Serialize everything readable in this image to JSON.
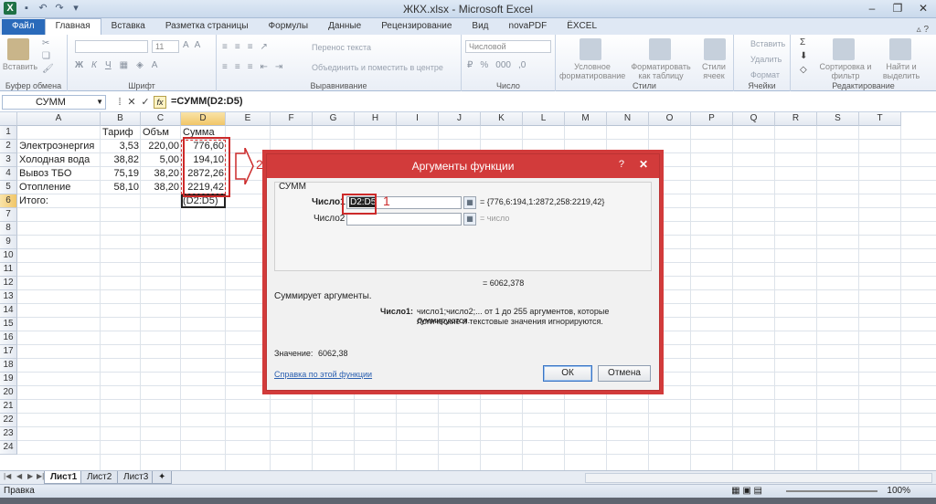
{
  "window": {
    "title": "ЖКХ.xlsx - Microsoft Excel"
  },
  "ribbon": {
    "tabs": [
      "Файл",
      "Главная",
      "Вставка",
      "Разметка страницы",
      "Формулы",
      "Данные",
      "Рецензирование",
      "Вид",
      "novaPDF",
      "ЁXCEL"
    ],
    "active_tab": "Главная",
    "groups": {
      "clipboard": {
        "label": "Буфер обмена",
        "paste": "Вставить"
      },
      "font": {
        "label": "Шрифт",
        "size": "11"
      },
      "alignment": {
        "label": "Выравнивание",
        "wrap": "Перенос текста",
        "merge": "Объединить и поместить в центре"
      },
      "number": {
        "label": "Число",
        "format": "Числовой"
      },
      "styles": {
        "label": "Стили",
        "cond": "Условное форматирование",
        "table": "Форматировать как таблицу",
        "cell": "Стили ячеек"
      },
      "cells": {
        "label": "Ячейки",
        "insert": "Вставить",
        "delete": "Удалить",
        "format": "Формат"
      },
      "editing": {
        "label": "Редактирование",
        "sort": "Сортировка и фильтр",
        "find": "Найти и выделить"
      }
    }
  },
  "formula_bar": {
    "name_box": "СУММ",
    "formula": "=СУММ(D2:D5)"
  },
  "grid": {
    "columns": [
      "A",
      "B",
      "C",
      "D",
      "E",
      "F",
      "G",
      "H",
      "I",
      "J",
      "K",
      "L",
      "M",
      "N",
      "O",
      "P",
      "Q",
      "R",
      "S",
      "T"
    ],
    "rows": [
      "1",
      "2",
      "3",
      "4",
      "5",
      "6",
      "7",
      "8",
      "9",
      "10",
      "11",
      "12",
      "13",
      "14",
      "15",
      "16",
      "17",
      "18",
      "19",
      "20",
      "21",
      "22",
      "23",
      "24"
    ],
    "cells": {
      "B1": "Тариф",
      "C1": "Объм",
      "D1": "Сумма",
      "A2": "Электроэнергия",
      "B2": "3,53",
      "C2": "220,00",
      "D2": "776,60",
      "A3": "Холодная вода",
      "B3": "38,82",
      "C3": "5,00",
      "D3": "194,10",
      "A4": "Вывоз ТБО",
      "B4": "75,19",
      "C4": "38,20",
      "D4": "2872,26",
      "A5": "Отопление",
      "B5": "58,10",
      "C5": "38,20",
      "D5": "2219,42",
      "A6": "Итого:",
      "D6": "(D2:D5)"
    }
  },
  "annotations": {
    "one": "1",
    "two": "2"
  },
  "dialog": {
    "title": "Аргументы функции",
    "help_glyph": "?",
    "close_glyph": "✕",
    "function_name": "СУММ",
    "arg1_label": "Число1",
    "arg1_value": "D2:D5",
    "arg1_result": "= {776,6:194,1:2872,258:2219,42}",
    "arg2_label": "Число2",
    "arg2_result": "= число",
    "total_result": "= 6062,378",
    "description": "Суммирует аргументы.",
    "arg_help_label": "Число1:",
    "arg_help_line1": "число1;число2;... от 1 до 255 аргументов, которые суммируются.",
    "arg_help_line2": "Логические и текстовые значения игнорируются.",
    "value_label": "Значение:",
    "value": "6062,38",
    "help_link": "Справка по этой функции",
    "ok": "ОК",
    "cancel": "Отмена"
  },
  "sheets": {
    "tabs": [
      "Лист1",
      "Лист2",
      "Лист3"
    ],
    "active": "Лист1"
  },
  "status": {
    "ready": "Правка",
    "zoom": "100%"
  }
}
